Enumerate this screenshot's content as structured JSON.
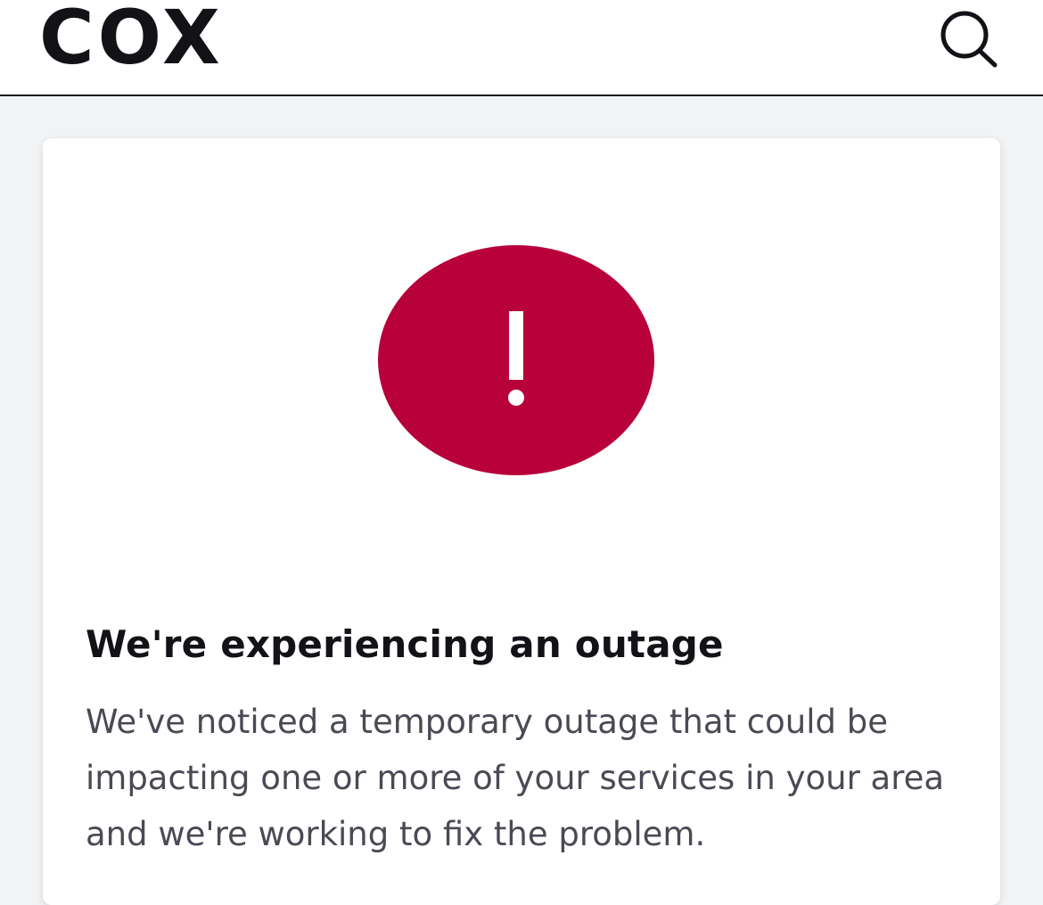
{
  "header": {
    "logo_text": "COX",
    "search_icon": "search-icon"
  },
  "alert": {
    "icon": "exclamation-alert-icon",
    "color": "#b8003b",
    "title": "We're experiencing an outage",
    "message": "We've noticed a temporary outage that could be impacting one or more of your services in your area and we're working to fix the problem."
  },
  "colors": {
    "page_background": "#f2f3f5",
    "card_background": "#ffffff",
    "text_primary": "#121217",
    "text_secondary": "#4a4a55"
  }
}
